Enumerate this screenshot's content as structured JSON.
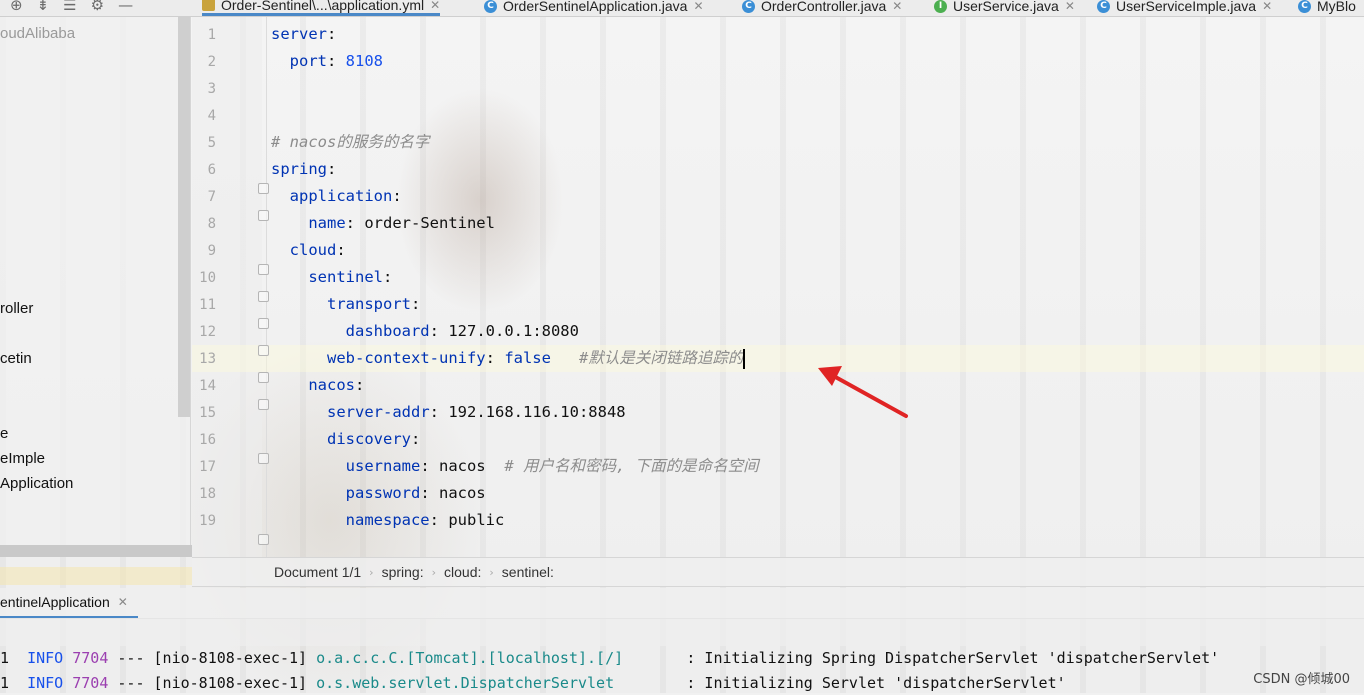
{
  "toolbar": {
    "icons": [
      "target-icon",
      "collapse-all-icon",
      "expand-icon",
      "gear-icon",
      "minimize-icon"
    ]
  },
  "tabs": [
    {
      "label": "Order-Sentinel\\...\\application.yml",
      "icon": "yaml-file-icon",
      "active": true
    },
    {
      "label": "OrderSentinelApplication.java",
      "icon": "class-icon"
    },
    {
      "label": "OrderController.java",
      "icon": "class-icon"
    },
    {
      "label": "UserService.java",
      "icon": "interface-icon"
    },
    {
      "label": "UserServiceImple.java",
      "icon": "class-icon"
    },
    {
      "label": "MyBlo",
      "icon": "class-icon"
    }
  ],
  "sidebar": {
    "project_title": "oudAlibaba",
    "items": [
      "roller",
      "cetin",
      "e",
      "eImple",
      "Application"
    ]
  },
  "editor": {
    "line_numbers": [
      "1",
      "2",
      "3",
      "4",
      "5",
      "6",
      "7",
      "8",
      "9",
      "10",
      "11",
      "12",
      "13",
      "14",
      "15",
      "16",
      "17",
      "18",
      "19"
    ],
    "lines": {
      "l1_key": "server",
      "l2_key": "port",
      "l2_val": "8108",
      "l5_comment": "# nacos的服务的名字",
      "l6_key": "spring",
      "l7_key": "application",
      "l8_key": "name",
      "l8_val": "order-Sentinel",
      "l9_key": "cloud",
      "l10_key": "sentinel",
      "l11_key": "transport",
      "l12_key": "dashboard",
      "l12_val": "127.0.0.1:8080",
      "l13_key": "web-context-unify",
      "l13_val": "false",
      "l13_comment": "#默认是关闭链路追踪的",
      "l14_key": "nacos",
      "l15_key": "server-addr",
      "l15_val": "192.168.116.10:8848",
      "l16_key": "discovery",
      "l17_key": "username",
      "l17_val": "nacos",
      "l17_comment": "# 用户名和密码, 下面的是命名空间",
      "l18_key": "password",
      "l18_val": "nacos",
      "l19_key": "namespace",
      "l19_val": "public"
    }
  },
  "breadcrumb": [
    "Document 1/1",
    "spring:",
    "cloud:",
    "sentinel:"
  ],
  "run": {
    "tab_label": "entinelApplication",
    "logs": [
      {
        "prefix": "1",
        "level": "INFO",
        "pid": "7704",
        "sep": "---",
        "thread": "[nio-8108-exec-1]",
        "logger": "o.a.c.c.C.[Tomcat].[localhost].[/]",
        "msg": ": Initializing Spring DispatcherServlet 'dispatcherServlet'"
      },
      {
        "prefix": "1",
        "level": "INFO",
        "pid": "7704",
        "sep": "---",
        "thread": "[nio-8108-exec-1]",
        "logger": "o.s.web.servlet.DispatcherServlet",
        "msg": ": Initializing Servlet 'dispatcherServlet'"
      }
    ]
  },
  "watermark": "CSDN @倾城00"
}
